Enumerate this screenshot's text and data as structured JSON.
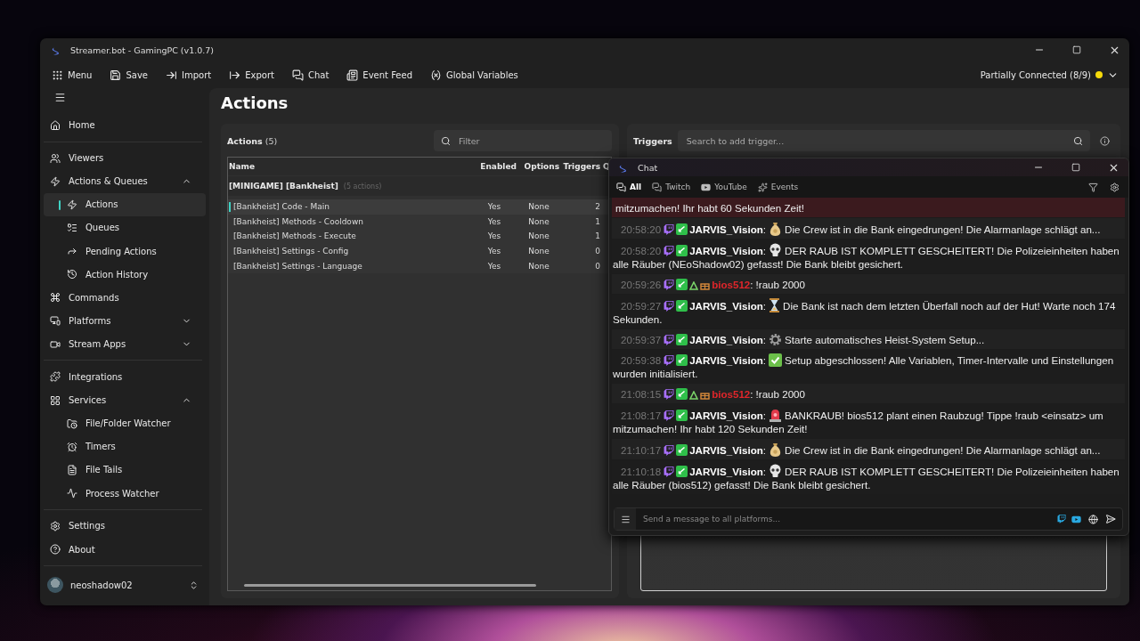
{
  "window": {
    "title": "Streamer.bot - GamingPC (v1.0.7)"
  },
  "toolbar": {
    "buttons": [
      "Menu",
      "Save",
      "Import",
      "Export",
      "Chat",
      "Event Feed",
      "Global Variables"
    ],
    "connection": {
      "label": "Partially Connected (8/9)",
      "color": "#f5d90a"
    }
  },
  "sidebar": {
    "sections": [
      {
        "items": [
          {
            "label": "Home",
            "selected": false
          }
        ]
      },
      {
        "items": [
          {
            "label": "Viewers",
            "selected": false
          },
          {
            "label": "Actions & Queues",
            "selected": false,
            "expanded": true,
            "children": [
              {
                "label": "Actions",
                "selected": true
              },
              {
                "label": "Queues",
                "selected": false
              },
              {
                "label": "Pending Actions",
                "selected": false
              },
              {
                "label": "Action History",
                "selected": false
              }
            ]
          },
          {
            "label": "Commands",
            "selected": false
          },
          {
            "label": "Platforms",
            "selected": false,
            "expanded": false
          },
          {
            "label": "Stream Apps",
            "selected": false,
            "expanded": false
          }
        ]
      },
      {
        "items": [
          {
            "label": "Integrations",
            "selected": false
          },
          {
            "label": "Services",
            "selected": false,
            "expanded": true,
            "children": [
              {
                "label": "File/Folder Watcher",
                "selected": false
              },
              {
                "label": "Timers",
                "selected": false
              },
              {
                "label": "File Tails",
                "selected": false
              },
              {
                "label": "Process Watcher",
                "selected": false
              }
            ]
          }
        ]
      },
      {
        "items": [
          {
            "label": "Settings",
            "selected": false
          },
          {
            "label": "About",
            "selected": false
          }
        ]
      }
    ],
    "user": {
      "name": "neoshadow02"
    }
  },
  "page": {
    "title": "Actions"
  },
  "actions_panel": {
    "title": "Actions",
    "count": "(5)",
    "filter": {
      "placeholder": "Filter"
    },
    "table": {
      "columns": [
        "Name",
        "Enabled",
        "Options",
        "Triggers",
        "Q"
      ],
      "groups": [
        {
          "name": "[MINIGAME] [Bankheist]",
          "count": "(5 actions)",
          "rows": [
            {
              "cells": [
                "[Bankheist] Code - Main",
                "Yes",
                "None",
                "2"
              ],
              "selected": true
            },
            {
              "cells": [
                "[Bankheist] Methods - Cooldown",
                "Yes",
                "None",
                "1"
              ],
              "selected": false
            },
            {
              "cells": [
                "[Bankheist] Methods - Execute",
                "Yes",
                "None",
                "1"
              ],
              "selected": false
            },
            {
              "cells": [
                "[Bankheist] Settings - Config",
                "Yes",
                "None",
                "0"
              ],
              "selected": false
            },
            {
              "cells": [
                "[Bankheist] Settings - Language",
                "Yes",
                "None",
                "0"
              ],
              "selected": false
            }
          ]
        }
      ]
    }
  },
  "triggers_panel": {
    "title": "Triggers",
    "search": {
      "placeholder": "Search to add trigger..."
    }
  },
  "chat": {
    "title": "Chat",
    "tabs": [
      {
        "label": "All",
        "selected": true
      },
      {
        "label": "Twitch",
        "selected": false
      },
      {
        "label": "YouTube",
        "selected": false
      },
      {
        "label": "Events",
        "selected": false
      }
    ],
    "messages": [
      {
        "kind": "continued",
        "text": "mitzumachen! Ihr habt 60 Sekunden Zeit!",
        "highlighted": true
      },
      {
        "kind": "moneybag",
        "time": "20:58:20",
        "user": "JARVIS_Vision",
        "color": "#ffffff",
        "separator": ":",
        "text": "Die Crew ist in die Bank eingedrungen! Die Alarmanlage schlägt an...",
        "highlighted": false
      },
      {
        "kind": "skull",
        "time": "20:58:20",
        "user": "JARVIS_Vision",
        "color": "#ffffff",
        "separator": ":",
        "text": "DER RAUB IST KOMPLETT GESCHEITERT! Die Polizeieinheiten haben alle Räuber (NEoShadow02) gefasst! Die Bank bleibt gesichert.",
        "highlighted": false
      },
      {
        "kind": "viewer",
        "time": "20:59:26",
        "user": "bios512",
        "color": "#e0262b",
        "separator": ":",
        "text": "!raub 2000",
        "highlighted": false
      },
      {
        "kind": "hourglass",
        "time": "20:59:27",
        "user": "JARVIS_Vision",
        "color": "#ffffff",
        "separator": ":",
        "text": "Die Bank ist nach dem letzten Überfall noch auf der Hut! Warte noch 174 Sekunden.",
        "highlighted": false
      },
      {
        "kind": "gear",
        "time": "20:59:37",
        "user": "JARVIS_Vision",
        "color": "#ffffff",
        "separator": ":",
        "text": "Starte automatisches Heist-System Setup...",
        "highlighted": false
      },
      {
        "kind": "check",
        "time": "20:59:38",
        "user": "JARVIS_Vision",
        "color": "#ffffff",
        "separator": ":",
        "text": "Setup abgeschlossen! Alle Variablen, Timer-Intervalle und Einstellungen wurden initialisiert.",
        "highlighted": false
      },
      {
        "kind": "viewer",
        "time": "21:08:15",
        "user": "bios512",
        "color": "#e0262b",
        "separator": ":",
        "text": "!raub 2000",
        "highlighted": false
      },
      {
        "kind": "siren",
        "time": "21:08:17",
        "user": "JARVIS_Vision",
        "color": "#ffffff",
        "separator": ":",
        "text": "BANKRAUB! bios512 plant einen Raubzug! Tippe !raub <einsatz> um mitzumachen! Ihr habt 120 Sekunden Zeit!",
        "highlighted": false
      },
      {
        "kind": "moneybag",
        "time": "21:10:17",
        "user": "JARVIS_Vision",
        "color": "#ffffff",
        "separator": ":",
        "text": "Die Crew ist in die Bank eingedrungen! Die Alarmanlage schlägt an...",
        "highlighted": false
      },
      {
        "kind": "skull",
        "time": "21:10:18",
        "user": "JARVIS_Vision",
        "color": "#ffffff",
        "separator": ":",
        "text": "DER RAUB IST KOMPLETT GESCHEITERT! Die Polizeieinheiten haben alle Räuber (bios512) gefasst! Die Bank bleibt gesichert.",
        "highlighted": false
      }
    ],
    "input": {
      "placeholder": "Send a message to all platforms..."
    }
  }
}
